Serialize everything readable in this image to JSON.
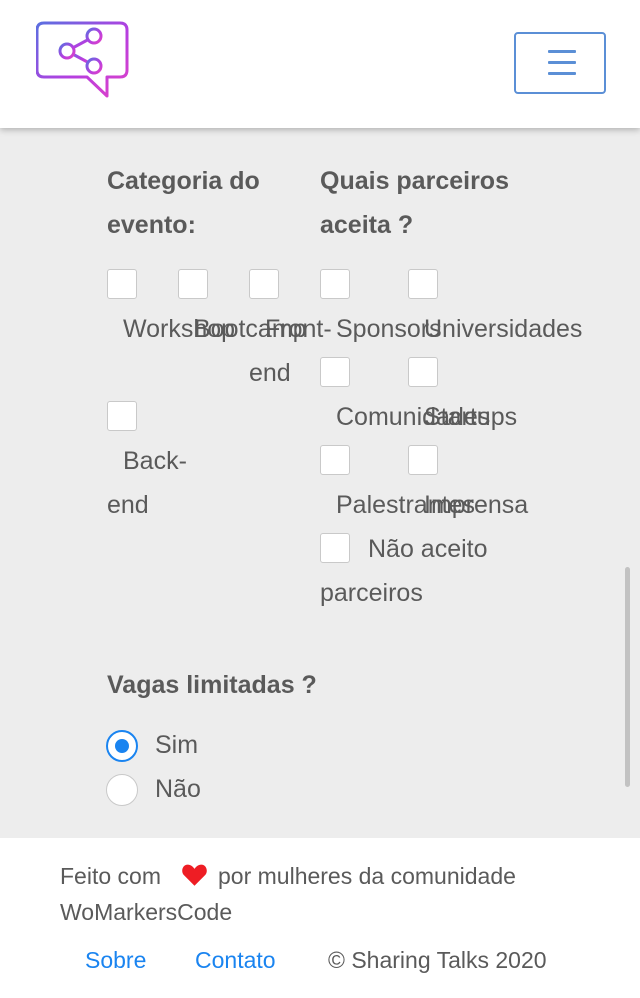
{
  "header": {
    "logo_icon": "share-speech-bubble-logo",
    "menu_icon": "hamburger-menu-icon",
    "brand_colors": [
      "#5b6fe0",
      "#b43fe0",
      "#e040c8"
    ],
    "accent_color": "#5b8fd6"
  },
  "form": {
    "category": {
      "heading_line1": "Categoria do",
      "heading_line2": "evento:",
      "options": {
        "workshop": "Workshop",
        "bootcamp": "Bootcamp",
        "front_line1": "Front-",
        "front_line2": "end",
        "back_line1": "Back-",
        "back_line2": "end"
      }
    },
    "partners": {
      "heading_line1": "Quais parceiros",
      "heading_line2": "aceita ?",
      "options": {
        "sponsors": "Sponsors",
        "universidades": "Universidades",
        "comunidades": "Comunidades",
        "startups": "Startups",
        "palestrantes": "Palestrantes",
        "imprensa": "Imprensa",
        "nao_aceito_line1": "Não aceito",
        "nao_aceito_line2": "parceiros"
      }
    },
    "vagas": {
      "heading": "Vagas limitadas ?",
      "options": [
        "Sim",
        "Não"
      ],
      "selected": "Sim"
    }
  },
  "footer": {
    "made_with_prefix": "Feito com",
    "made_with_suffix": "por mulheres da comunidade",
    "community": "WoMarkersCode",
    "heart_color": "#ee1d24",
    "links": {
      "sobre": "Sobre",
      "contato": "Contato"
    },
    "copyright": "© Sharing Talks 2020",
    "link_color": "#1a84f0"
  }
}
